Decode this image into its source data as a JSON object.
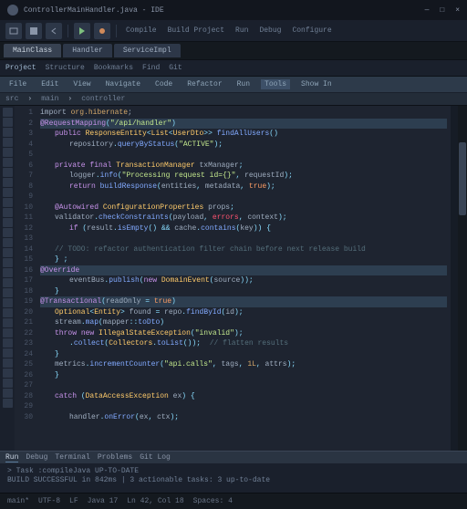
{
  "title": "ControllerMainHandler.java - IDE",
  "toolbar": {
    "labels": [
      "Compile",
      "Build Project",
      "Run",
      "Debug",
      "Configure"
    ]
  },
  "tabs": [
    "MainClass",
    "Handler",
    "ServiceImpl"
  ],
  "subbar": [
    "Project",
    "Structure",
    "Bookmarks",
    "Find",
    "Git"
  ],
  "find": {
    "items": [
      "File",
      "Edit",
      "View",
      "Navigate",
      "Code",
      "Refactor",
      "Run",
      "Tools",
      "Show In"
    ]
  },
  "breadcrumb": [
    "src",
    "main",
    "controller"
  ],
  "code": [
    {
      "cls": "",
      "seg": [
        {
          "c": "id",
          "t": "import"
        },
        {
          "c": "",
          "t": " "
        },
        {
          "c": "nm",
          "t": "org.hibernate"
        },
        {
          "c": "",
          "t": ";"
        }
      ]
    },
    {
      "cls": "hl",
      "seg": [
        {
          "c": "kw",
          "t": "@RequestMapping"
        },
        {
          "c": "op",
          "t": "("
        },
        {
          "c": "str",
          "t": "\"/api/handler\""
        },
        {
          "c": "op",
          "t": ")"
        }
      ]
    },
    {
      "cls": "i1",
      "seg": [
        {
          "c": "kw",
          "t": "public"
        },
        {
          "c": "",
          "t": " "
        },
        {
          "c": "ty",
          "t": "ResponseEntity"
        },
        {
          "c": "op",
          "t": "<"
        },
        {
          "c": "ty",
          "t": "List"
        },
        {
          "c": "op",
          "t": "<"
        },
        {
          "c": "ty",
          "t": "UserDto"
        },
        {
          "c": "op",
          "t": ">> "
        },
        {
          "c": "fn",
          "t": "findAllUsers"
        },
        {
          "c": "op",
          "t": "()"
        }
      ]
    },
    {
      "cls": "i2",
      "seg": [
        {
          "c": "id",
          "t": "repository"
        },
        {
          "c": "op",
          "t": "."
        },
        {
          "c": "fn",
          "t": "queryByStatus"
        },
        {
          "c": "op",
          "t": "("
        },
        {
          "c": "str",
          "t": "\"ACTIVE\""
        },
        {
          "c": "op",
          "t": ");"
        }
      ]
    },
    {
      "cls": "",
      "seg": [
        {
          "c": "",
          "t": ""
        }
      ]
    },
    {
      "cls": "i1",
      "seg": [
        {
          "c": "kw",
          "t": "private"
        },
        {
          "c": "",
          "t": " "
        },
        {
          "c": "kw",
          "t": "final"
        },
        {
          "c": "",
          "t": " "
        },
        {
          "c": "ty",
          "t": "TransactionManager"
        },
        {
          "c": "",
          "t": " "
        },
        {
          "c": "id",
          "t": "txManager"
        },
        {
          "c": "op",
          "t": ";"
        }
      ]
    },
    {
      "cls": "i2",
      "seg": [
        {
          "c": "id",
          "t": "logger"
        },
        {
          "c": "op",
          "t": "."
        },
        {
          "c": "fn",
          "t": "info"
        },
        {
          "c": "op",
          "t": "("
        },
        {
          "c": "str",
          "t": "\"Processing request id={}\""
        },
        {
          "c": "op",
          "t": ", "
        },
        {
          "c": "id",
          "t": "requestId"
        },
        {
          "c": "op",
          "t": ");"
        }
      ]
    },
    {
      "cls": "i2",
      "seg": [
        {
          "c": "kw",
          "t": "return"
        },
        {
          "c": "",
          "t": " "
        },
        {
          "c": "fn",
          "t": "buildResponse"
        },
        {
          "c": "op",
          "t": "("
        },
        {
          "c": "id",
          "t": "entities"
        },
        {
          "c": "op",
          "t": ","
        },
        {
          "c": "",
          "t": " "
        },
        {
          "c": "id",
          "t": "metadata"
        },
        {
          "c": "op",
          "t": ","
        },
        {
          "c": "",
          "t": " "
        },
        {
          "c": "bool",
          "t": "true"
        },
        {
          "c": "op",
          "t": ");"
        }
      ]
    },
    {
      "cls": "",
      "seg": [
        {
          "c": "",
          "t": ""
        }
      ]
    },
    {
      "cls": "i1",
      "seg": [
        {
          "c": "kw",
          "t": "@Autowired"
        },
        {
          "c": "",
          "t": " "
        },
        {
          "c": "ty",
          "t": "ConfigurationProperties"
        },
        {
          "c": "",
          "t": " "
        },
        {
          "c": "id",
          "t": "props"
        },
        {
          "c": "op",
          "t": ";"
        }
      ]
    },
    {
      "cls": "i1",
      "seg": [
        {
          "c": "id",
          "t": "validator"
        },
        {
          "c": "op",
          "t": "."
        },
        {
          "c": "fn",
          "t": "checkConstraints"
        },
        {
          "c": "op",
          "t": "("
        },
        {
          "c": "id",
          "t": "payload"
        },
        {
          "c": "op",
          "t": ","
        },
        {
          "c": "",
          "t": " "
        },
        {
          "c": "pr",
          "t": "errors"
        },
        {
          "c": "op",
          "t": ","
        },
        {
          "c": "",
          "t": " "
        },
        {
          "c": "id",
          "t": "context"
        },
        {
          "c": "op",
          "t": ");"
        }
      ]
    },
    {
      "cls": "i2",
      "seg": [
        {
          "c": "kw",
          "t": "if"
        },
        {
          "c": "op",
          "t": " ("
        },
        {
          "c": "id",
          "t": "result"
        },
        {
          "c": "op",
          "t": "."
        },
        {
          "c": "fn",
          "t": "isEmpty"
        },
        {
          "c": "op",
          "t": "() && "
        },
        {
          "c": "id",
          "t": "cache"
        },
        {
          "c": "op",
          "t": "."
        },
        {
          "c": "fn",
          "t": "contains"
        },
        {
          "c": "op",
          "t": "("
        },
        {
          "c": "id",
          "t": "key"
        },
        {
          "c": "op",
          "t": ")) {"
        }
      ]
    },
    {
      "cls": "",
      "seg": [
        {
          "c": "",
          "t": ""
        }
      ]
    },
    {
      "cls": "i1",
      "seg": [
        {
          "c": "cm",
          "t": "// TODO: refactor authentication filter chain before next release build"
        }
      ]
    },
    {
      "cls": "i1",
      "seg": [
        {
          "c": "op",
          "t": "}"
        },
        {
          "c": "",
          "t": " "
        },
        {
          "c": "op",
          "t": ";"
        }
      ]
    },
    {
      "cls": "hl",
      "seg": [
        {
          "c": "kw",
          "t": "@Override"
        }
      ]
    },
    {
      "cls": "i2",
      "seg": [
        {
          "c": "id",
          "t": "eventBus"
        },
        {
          "c": "op",
          "t": "."
        },
        {
          "c": "fn",
          "t": "publish"
        },
        {
          "c": "op",
          "t": "("
        },
        {
          "c": "kw",
          "t": "new"
        },
        {
          "c": "",
          "t": " "
        },
        {
          "c": "ty",
          "t": "DomainEvent"
        },
        {
          "c": "op",
          "t": "("
        },
        {
          "c": "id",
          "t": "source"
        },
        {
          "c": "op",
          "t": "));"
        }
      ]
    },
    {
      "cls": "i1",
      "seg": [
        {
          "c": "op",
          "t": "}"
        }
      ]
    },
    {
      "cls": "hl",
      "seg": [
        {
          "c": "kw",
          "t": "@Transactional"
        },
        {
          "c": "op",
          "t": "("
        },
        {
          "c": "id",
          "t": "readOnly"
        },
        {
          "c": "op",
          "t": " = "
        },
        {
          "c": "bool",
          "t": "true"
        },
        {
          "c": "op",
          "t": ")"
        }
      ]
    },
    {
      "cls": "i1",
      "seg": [
        {
          "c": "ty",
          "t": "Optional"
        },
        {
          "c": "op",
          "t": "<"
        },
        {
          "c": "ty",
          "t": "Entity"
        },
        {
          "c": "op",
          "t": "> "
        },
        {
          "c": "id",
          "t": "found"
        },
        {
          "c": "",
          "t": " "
        },
        {
          "c": "op",
          "t": "="
        },
        {
          "c": "",
          "t": " "
        },
        {
          "c": "id",
          "t": "repo"
        },
        {
          "c": "op",
          "t": "."
        },
        {
          "c": "fn",
          "t": "findById"
        },
        {
          "c": "op",
          "t": "("
        },
        {
          "c": "id",
          "t": "id"
        },
        {
          "c": "op",
          "t": ");"
        }
      ]
    },
    {
      "cls": "i1",
      "seg": [
        {
          "c": "id",
          "t": "stream"
        },
        {
          "c": "op",
          "t": "."
        },
        {
          "c": "fn",
          "t": "map"
        },
        {
          "c": "op",
          "t": "("
        },
        {
          "c": "id",
          "t": "mapper"
        },
        {
          "c": "op",
          "t": "::"
        },
        {
          "c": "fn",
          "t": "toDto"
        },
        {
          "c": "op",
          "t": ")"
        }
      ]
    },
    {
      "cls": "i1",
      "seg": [
        {
          "c": "kw",
          "t": "throw"
        },
        {
          "c": "",
          "t": " "
        },
        {
          "c": "kw",
          "t": "new"
        },
        {
          "c": "",
          "t": " "
        },
        {
          "c": "ty",
          "t": "IllegalStateException"
        },
        {
          "c": "op",
          "t": "("
        },
        {
          "c": "str",
          "t": "\"invalid\""
        },
        {
          "c": "op",
          "t": ");"
        }
      ]
    },
    {
      "cls": "i2",
      "seg": [
        {
          "c": "op",
          "t": "."
        },
        {
          "c": "fn",
          "t": "collect"
        },
        {
          "c": "op",
          "t": "("
        },
        {
          "c": "ty",
          "t": "Collectors"
        },
        {
          "c": "op",
          "t": "."
        },
        {
          "c": "fn",
          "t": "toList"
        },
        {
          "c": "op",
          "t": "());  "
        },
        {
          "c": "cm",
          "t": "// flatten results"
        }
      ]
    },
    {
      "cls": "i1",
      "seg": [
        {
          "c": "op",
          "t": "}"
        }
      ]
    },
    {
      "cls": "i1",
      "seg": [
        {
          "c": "id",
          "t": "metrics"
        },
        {
          "c": "op",
          "t": "."
        },
        {
          "c": "fn",
          "t": "incrementCounter"
        },
        {
          "c": "op",
          "t": "("
        },
        {
          "c": "str",
          "t": "\"api.calls\""
        },
        {
          "c": "op",
          "t": ","
        },
        {
          "c": "",
          "t": " "
        },
        {
          "c": "id",
          "t": "tags"
        },
        {
          "c": "op",
          "t": ","
        },
        {
          "c": "",
          "t": " "
        },
        {
          "c": "nm",
          "t": "1L"
        },
        {
          "c": "op",
          "t": ","
        },
        {
          "c": "",
          "t": " "
        },
        {
          "c": "id",
          "t": "attrs"
        },
        {
          "c": "op",
          "t": ");"
        }
      ]
    },
    {
      "cls": "i1",
      "seg": [
        {
          "c": "op",
          "t": "}"
        }
      ]
    },
    {
      "cls": "",
      "seg": [
        {
          "c": "",
          "t": ""
        }
      ]
    },
    {
      "cls": "i1",
      "seg": [
        {
          "c": "kw",
          "t": "catch"
        },
        {
          "c": "op",
          "t": " ("
        },
        {
          "c": "ty",
          "t": "DataAccessException"
        },
        {
          "c": "",
          "t": " "
        },
        {
          "c": "id",
          "t": "ex"
        },
        {
          "c": "op",
          "t": ") {"
        }
      ]
    },
    {
      "cls": "",
      "seg": [
        {
          "c": "",
          "t": ""
        }
      ]
    },
    {
      "cls": "i2",
      "seg": [
        {
          "c": "id",
          "t": "handler"
        },
        {
          "c": "op",
          "t": "."
        },
        {
          "c": "fn",
          "t": "onError"
        },
        {
          "c": "op",
          "t": "("
        },
        {
          "c": "id",
          "t": "ex"
        },
        {
          "c": "op",
          "t": ","
        },
        {
          "c": "",
          "t": " "
        },
        {
          "c": "id",
          "t": "ctx"
        },
        {
          "c": "op",
          "t": ");"
        }
      ]
    }
  ],
  "panel": {
    "tabs": [
      "Run",
      "Debug",
      "Terminal",
      "Problems",
      "Git Log"
    ]
  },
  "console": [
    "> Task :compileJava UP-TO-DATE",
    "BUILD SUCCESSFUL in 842ms  |  3 actionable tasks: 3 up-to-date"
  ],
  "status": [
    "main*",
    "UTF-8",
    "LF",
    "Java 17",
    "Ln 42, Col 18",
    "Spaces: 4"
  ]
}
